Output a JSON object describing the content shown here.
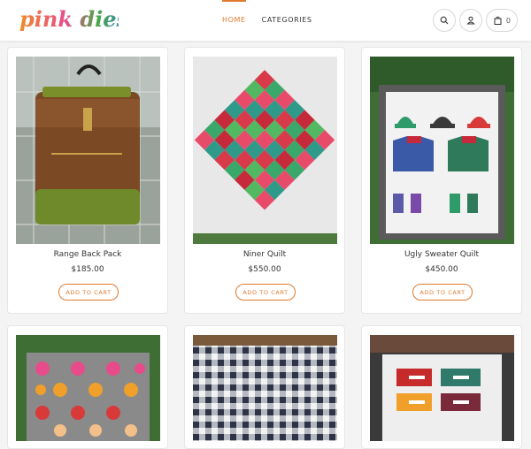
{
  "brand": {
    "logo_text": "pink diesel"
  },
  "nav": {
    "items": [
      {
        "label": "HOME",
        "active": true
      },
      {
        "label": "CATEGORIES",
        "active": false
      }
    ]
  },
  "header_icons": {
    "search": "search-icon",
    "account": "user-icon",
    "cart": "bag-icon",
    "cart_count": "0"
  },
  "colors": {
    "accent": "#e07a2e"
  },
  "products": [
    {
      "name": "Range Back Pack",
      "price": "$185.00",
      "cta": "ADD TO CART"
    },
    {
      "name": "Niner Quilt",
      "price": "$550.00",
      "cta": "ADD TO CART"
    },
    {
      "name": "Ugly Sweater Quilt",
      "price": "$450.00",
      "cta": "ADD TO CART"
    }
  ]
}
